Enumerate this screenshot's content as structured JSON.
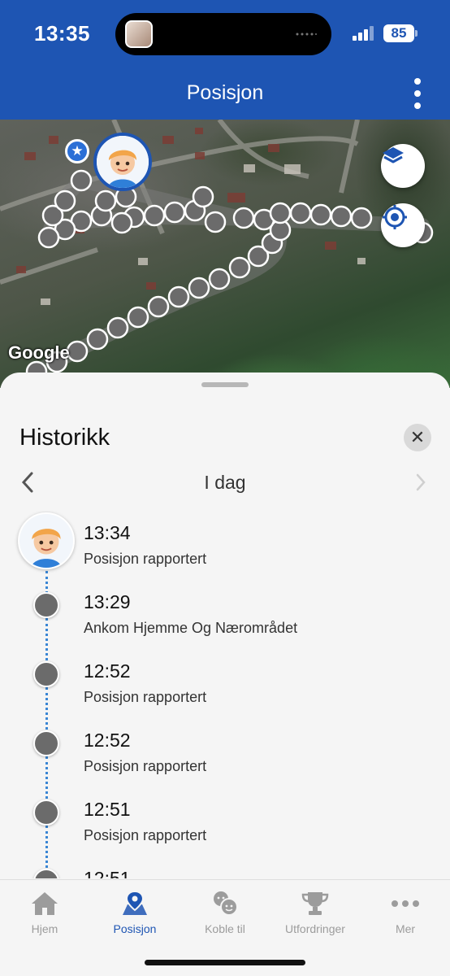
{
  "status_bar": {
    "time": "13:35",
    "battery": "85"
  },
  "header": {
    "title": "Posisjon",
    "menu_icon": "kebab-menu-icon",
    "background": "#1e55b3"
  },
  "map": {
    "attribution": "Google",
    "layers_icon": "layers-icon",
    "locate_icon": "my-location-icon",
    "favorite_icon": "star-icon",
    "accent": "#2b6fd6"
  },
  "history": {
    "title": "Historikk",
    "close_icon": "close-icon",
    "day_label": "I dag",
    "entries": [
      {
        "time": "13:34",
        "description": "Posisjon rapportert"
      },
      {
        "time": "13:29",
        "description": "Ankom Hjemme Og Nærområdet"
      },
      {
        "time": "12:52",
        "description": "Posisjon rapportert"
      },
      {
        "time": "12:52",
        "description": "Posisjon rapportert"
      },
      {
        "time": "12:51",
        "description": "Posisjon rapportert"
      },
      {
        "time": "12:51",
        "description": ""
      }
    ]
  },
  "bottom_nav": {
    "active_color": "#1e55b3",
    "items": [
      {
        "label": "Hjem",
        "icon": "home-icon"
      },
      {
        "label": "Posisjon",
        "icon": "map-pin-icon"
      },
      {
        "label": "Koble til",
        "icon": "chat-faces-icon"
      },
      {
        "label": "Utfordringer",
        "icon": "trophy-icon"
      },
      {
        "label": "Mer",
        "icon": "more-dots-icon"
      }
    ]
  }
}
